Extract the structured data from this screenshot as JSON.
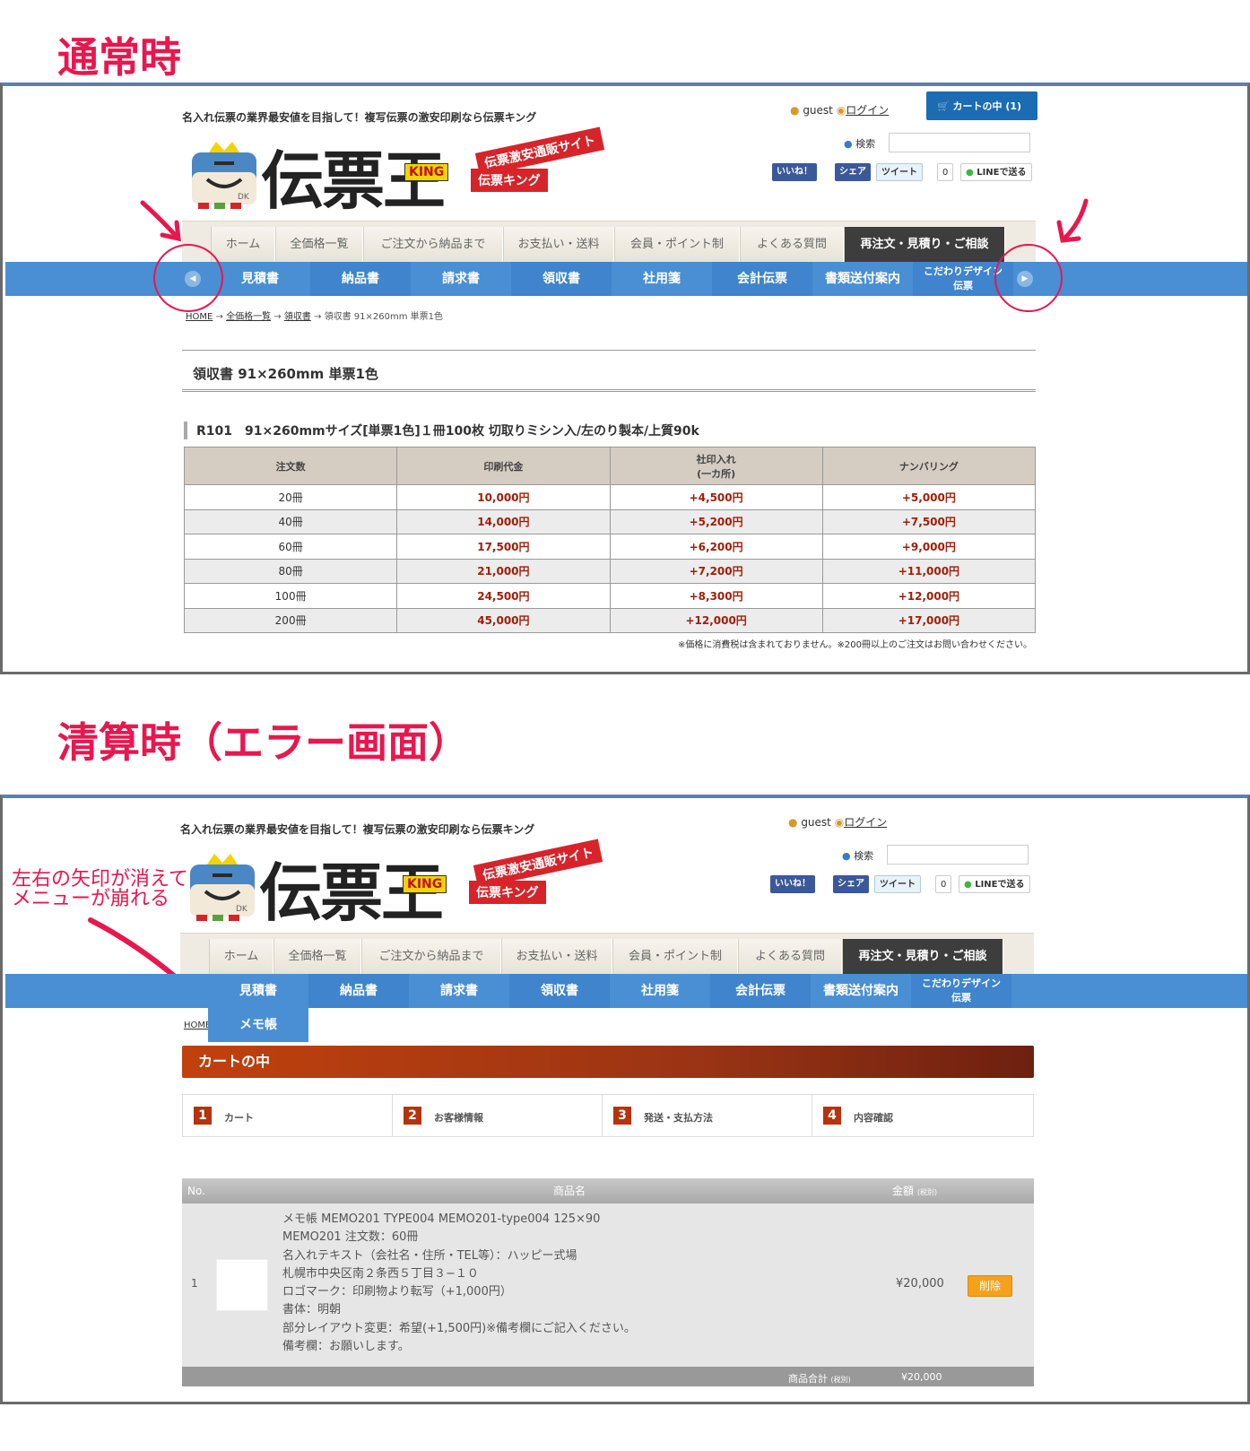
{
  "sections": {
    "normal_title": "通常時",
    "error_title": "清算時（エラー画面）"
  },
  "header": {
    "tagline": "名入れ伝票の業界最安値を目指して！複写伝票の激安印刷なら伝票キング",
    "logo_text": "伝票王",
    "king": "KING",
    "tag1": "伝票激安通販サイト",
    "tag2": "伝票キング",
    "mascot_mark": "DK",
    "user": "guest",
    "login": "ログイン",
    "cart": "カートの中 (1)",
    "search": "検索",
    "fb": "いいね！",
    "share": "シェア",
    "tweet": "ツイート",
    "count": "0",
    "line": "LINEで送る"
  },
  "top_nav": [
    "ホーム",
    "全価格一覧",
    "ご注文から納品まで",
    "お支払い・送料",
    "会員・ポイント制",
    "よくある質問",
    "再注文・見積り・ご相談"
  ],
  "blue_nav": [
    "見積書",
    "納品書",
    "請求書",
    "領収書",
    "社用箋",
    "会計伝票",
    "書類送付案内"
  ],
  "blue_nav_last": {
    "l1": "こだわりデザイン",
    "l2": "伝票"
  },
  "breadcrumb": {
    "home": "HOME",
    "list": "全価格一覧",
    "cat": "領収書",
    "cur": "領収書 91×260mm 単票1色"
  },
  "page_title": "領収書 91×260mm 単票1色",
  "product_title": "R101　91×260mmサイズ[単票1色]１冊100枚 切取りミシン入/左のり製本/上質90k",
  "price_table": {
    "headers": [
      "注文数",
      "印刷代金",
      "社印入れ",
      "(一カ所)",
      "ナンバリング"
    ],
    "rows": [
      [
        "20冊",
        "10,000円",
        "+4,500円",
        "+5,000円"
      ],
      [
        "40冊",
        "14,000円",
        "+5,200円",
        "+7,500円"
      ],
      [
        "60冊",
        "17,500円",
        "+6,200円",
        "+9,000円"
      ],
      [
        "80冊",
        "21,000円",
        "+7,200円",
        "+11,000円"
      ],
      [
        "100冊",
        "24,500円",
        "+8,300円",
        "+12,000円"
      ],
      [
        "200冊",
        "45,000円",
        "+12,000円",
        "+17,000円"
      ]
    ],
    "note": "※価格に消費税は含まれておりません。※200冊以上のご注文はお問い合わせください。"
  },
  "annotation": {
    "line1": "左右の矢印が消えて",
    "line2": "メニューが崩れる"
  },
  "dropdown_item": "メモ帳",
  "cart": {
    "bar": "カートの中",
    "steps": [
      {
        "n": "1",
        "label": "カート"
      },
      {
        "n": "2",
        "label": "お客様情報"
      },
      {
        "n": "3",
        "label": "発送・支払方法"
      },
      {
        "n": "4",
        "label": "内容確認"
      }
    ],
    "cols": {
      "no": "No.",
      "name": "商品名",
      "amount": "金額",
      "tax": "(税別)"
    },
    "item": {
      "no": "1",
      "lines": [
        "メモ帳 MEMO201 TYPE004 MEMO201-type004 125×90",
        "MEMO201 注文数：60冊",
        "名入れテキスト（会社名・住所・TEL等）：ハッピー式場",
        "札幌市中央区南２条西５丁目３−１０",
        "ロゴマーク：印刷物より転写（+1,000円）",
        "書体：明朝",
        "部分レイアウト変更：希望(+1,500円)※備考欄にご記入ください。",
        "備考欄：お願いします。"
      ],
      "price": "¥20,000",
      "delete": "削除"
    },
    "subtotal_label": "商品合計",
    "subtotal_tax": "(税別)",
    "subtotal": "¥20,000"
  },
  "colors": {
    "accent": "#e8174e",
    "nav_blue": "#4a8fd3",
    "cart_brown": "#9b3414"
  }
}
